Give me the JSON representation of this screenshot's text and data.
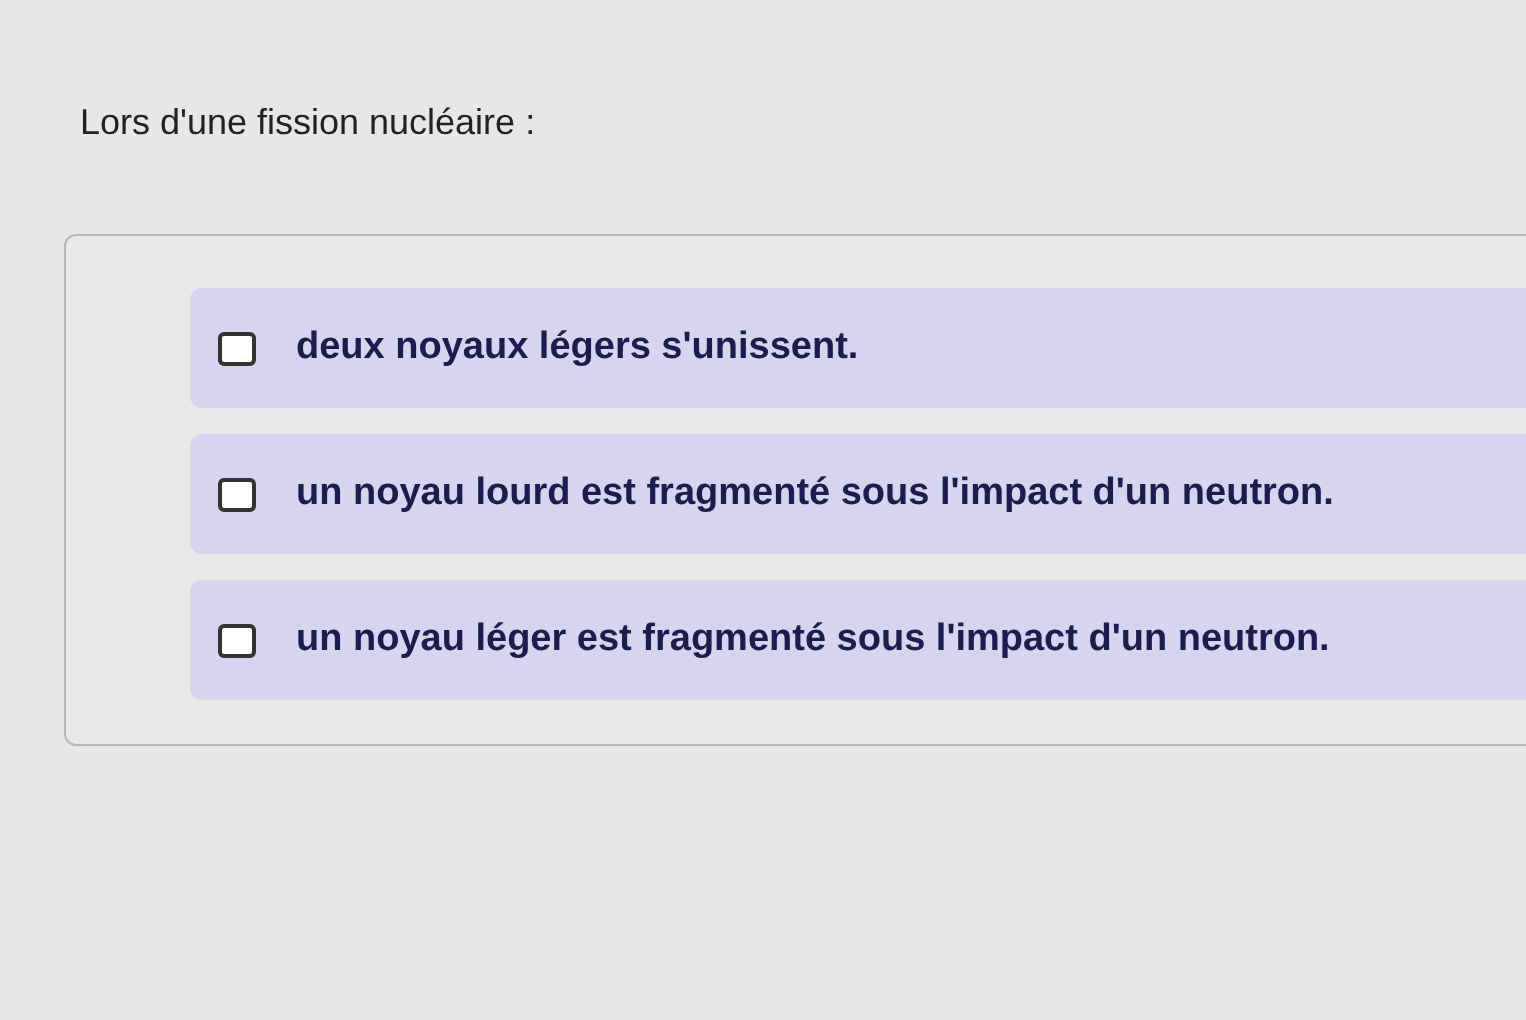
{
  "question": "Lors d'une fission nucléaire :",
  "options": [
    {
      "label": "deux noyaux légers s'unissent.",
      "checked": false
    },
    {
      "label": "un noyau lourd est fragmenté sous l'impact d'un neutron.",
      "checked": false
    },
    {
      "label": "un noyau léger est fragmenté sous l'impact d'un neutron.",
      "checked": false
    }
  ]
}
